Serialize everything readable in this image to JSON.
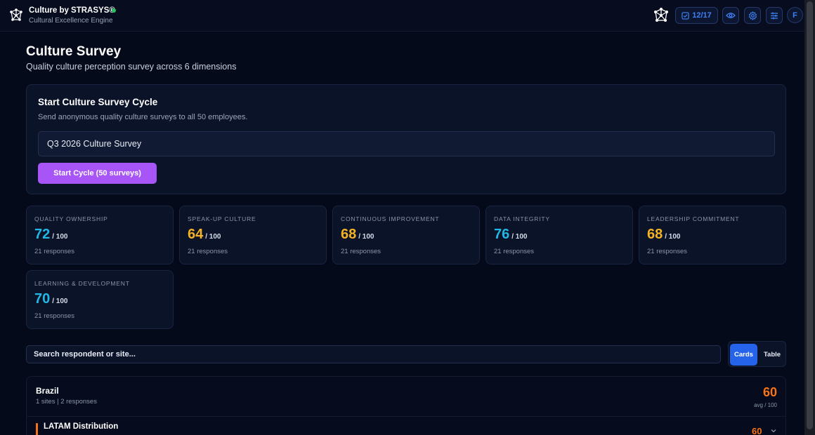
{
  "header": {
    "brand_title": "Culture by STRASYS®",
    "brand_subtitle": "Cultural Excellence Engine",
    "tasks_count": "12/17",
    "avatar_initial": "F",
    "logo_icon": "network-icon",
    "status_color": "#22c55e"
  },
  "page": {
    "title": "Culture Survey",
    "subtitle": "Quality culture perception survey across 6 dimensions"
  },
  "cycle": {
    "title": "Start Culture Survey Cycle",
    "description": "Send anonymous quality culture surveys to all 50 employees.",
    "input_value": "Q3 2026 Culture Survey",
    "button_label": "Start Cycle (50 surveys)",
    "button_color": "#a855f7"
  },
  "dimensions": [
    {
      "name": "Quality Ownership",
      "score": "72",
      "of": "/ 100",
      "responses": "21 responses",
      "color": "#22b8e6"
    },
    {
      "name": "Speak-Up Culture",
      "score": "64",
      "of": "/ 100",
      "responses": "21 responses",
      "color": "#f5b324"
    },
    {
      "name": "Continuous Improvement",
      "score": "68",
      "of": "/ 100",
      "responses": "21 responses",
      "color": "#f5b324"
    },
    {
      "name": "Data Integrity",
      "score": "76",
      "of": "/ 100",
      "responses": "21 responses",
      "color": "#22b8e6"
    },
    {
      "name": "Leadership Commitment",
      "score": "68",
      "of": "/ 100",
      "responses": "21 responses",
      "color": "#f5b324"
    },
    {
      "name": "Learning & Development",
      "score": "70",
      "of": "/ 100",
      "responses": "21 responses",
      "color": "#22b8e6"
    }
  ],
  "filters": {
    "search_placeholder": "Search respondent or site...",
    "view_cards": "Cards",
    "view_table": "Table",
    "active_view": "Cards"
  },
  "countries": [
    {
      "name": "Brazil",
      "meta": "1 sites | 2 responses",
      "avg": "60",
      "avg_label": "avg / 100",
      "sites": [
        {
          "name": "LATAM Distribution",
          "score": "60"
        }
      ]
    }
  ]
}
